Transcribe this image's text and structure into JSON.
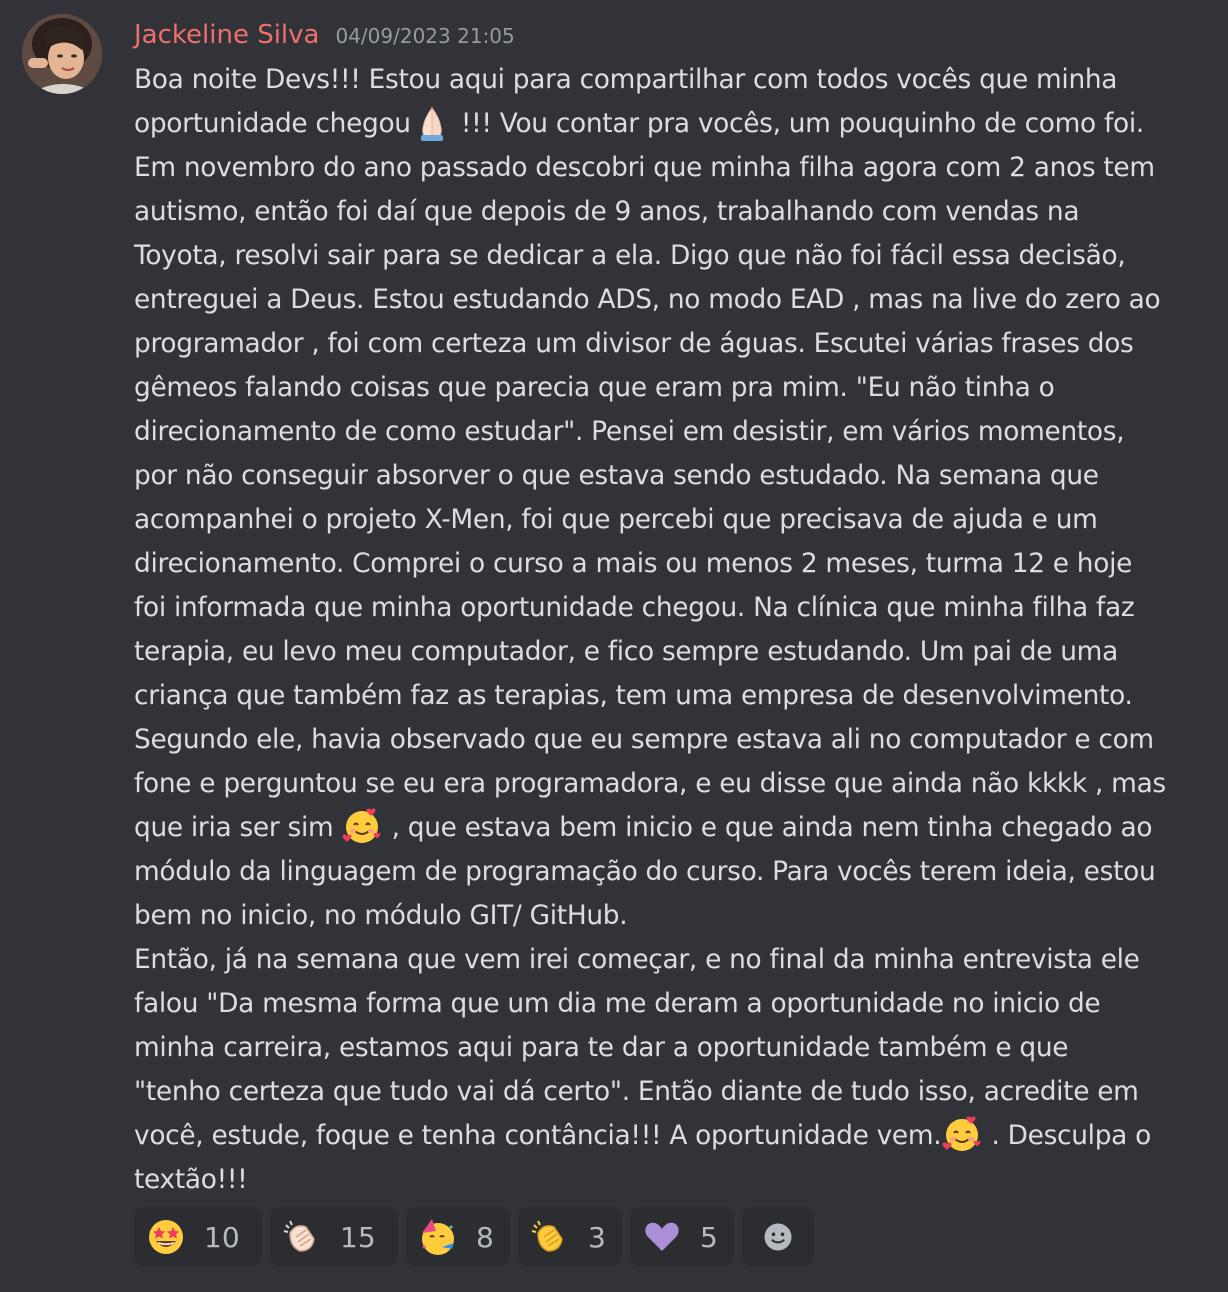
{
  "message": {
    "author": "Jackeline Silva",
    "timestamp": "04/09/2023 21:05",
    "author_color": "#ef6f6c",
    "lines": [
      [
        "Boa noite Devs!!! Estou aqui para compartilhar com todos vocês que minha"
      ],
      [
        "oportunidade chegou",
        " !!! Vou  contar pra vocês, um pouquinho de como foi."
      ],
      [
        "Em novembro do ano passado descobri que minha filha agora com 2 anos tem"
      ],
      [
        "autismo, então foi daí que depois de 9 anos, trabalhando com vendas na"
      ],
      [
        "Toyota, resolvi sair para se dedicar a ela. Digo que não foi fácil essa decisão,"
      ],
      [
        "entreguei a Deus. Estou estudando ADS, no modo EAD , mas na live do zero ao"
      ],
      [
        "programador , foi com certeza um divisor de águas. Escutei várias frases dos"
      ],
      [
        "gêmeos falando coisas que parecia que eram pra mim. \"Eu não tinha o"
      ],
      [
        "direcionamento de como estudar\". Pensei em desistir, em vários momentos,"
      ],
      [
        "por não conseguir absorver o que estava sendo estudado.  Na semana que"
      ],
      [
        "acompanhei o projeto X-Men,  foi que percebi que precisava de ajuda e um"
      ],
      [
        "direcionamento. Comprei o curso a mais ou menos 2 meses, turma 12 e hoje"
      ],
      [
        "foi informada que minha oportunidade chegou. Na clínica que minha filha faz"
      ],
      [
        "terapia, eu levo meu computador, e fico sempre estudando. Um pai  de uma"
      ],
      [
        "criança que também faz as terapias, tem uma empresa de desenvolvimento."
      ],
      [
        "Segundo ele,  havia observado que eu sempre estava ali no computador e com"
      ],
      [
        "fone e perguntou se eu era programadora, e eu disse que ainda não kkkk , mas"
      ],
      [
        "que iria ser sim ",
        " , que estava bem inicio e que ainda nem tinha chegado ao"
      ],
      [
        "módulo da linguagem de programação do curso. Para vocês terem ideia, estou"
      ],
      [
        "bem no inicio, no módulo GIT/ GitHub."
      ],
      [
        "Então, já na semana que vem irei começar, e no final da  minha entrevista ele"
      ],
      [
        "falou \"Da mesma forma que um dia me deram a oportunidade no inicio de"
      ],
      [
        "minha carreira, estamos aqui para te dar a oportunidade também e que"
      ],
      [
        "\"tenho certeza que tudo vai dá certo\".  Então diante de tudo isso, acredite em"
      ],
      [
        "você, estude, foque e tenha contância!!! A oportunidade vem.",
        " . Desculpa o"
      ],
      [
        "textão!!!"
      ]
    ],
    "inline_emojis": {
      "line1": "folded-hands-emoji",
      "line17": "smiling-face-with-hearts-emoji",
      "line24": "smiling-face-with-hearts-emoji"
    }
  },
  "reactions": [
    {
      "icon": "star-struck-emoji",
      "count": "10"
    },
    {
      "icon": "clapping-hands-light-emoji",
      "count": "15"
    },
    {
      "icon": "partying-face-emoji",
      "count": "8"
    },
    {
      "icon": "clapping-hands-emoji",
      "count": "3"
    },
    {
      "icon": "purple-heart-emoji",
      "count": "5"
    }
  ],
  "add_reaction_icon": "add-reaction-smiley-icon",
  "colors": {
    "background": "#313338",
    "text": "#dbdee1",
    "timestamp": "#949ba4",
    "reaction_bg": "#2b2d31"
  }
}
